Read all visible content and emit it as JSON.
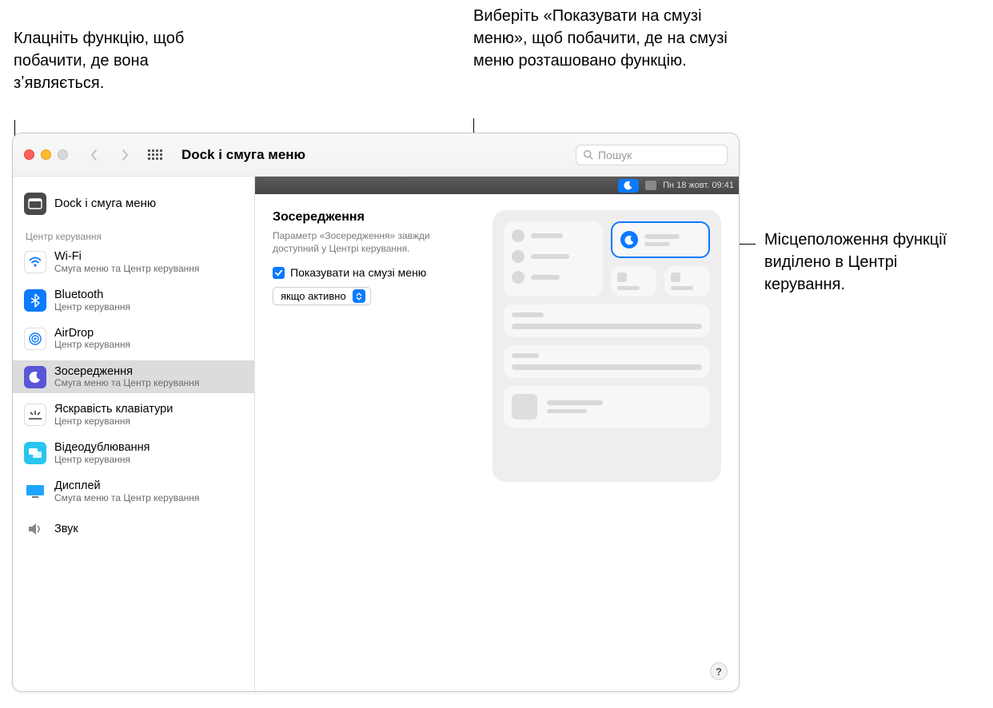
{
  "callouts": {
    "left": "Клацніть функцію, щоб побачити, де вона зʼявляється.",
    "top": "Виберіть «Показувати на смузі меню», щоб побачити, де на смузі меню розташовано функцію.",
    "right": "Місцеположення функції виділено в Центрі керування."
  },
  "toolbar": {
    "title": "Dock і смуга меню",
    "search_placeholder": "Пошук"
  },
  "preview_bar": {
    "datetime": "Пн 18 жовт.  09:41"
  },
  "sidebar": {
    "top": {
      "label": "Dock і смуга меню"
    },
    "section": "Центр керування",
    "items": [
      {
        "label": "Wi-Fi",
        "sub": "Смуга меню та Центр керування",
        "icon": "wifi"
      },
      {
        "label": "Bluetooth",
        "sub": "Центр керування",
        "icon": "bt"
      },
      {
        "label": "AirDrop",
        "sub": "Центр керування",
        "icon": "airdrop"
      },
      {
        "label": "Зосередження",
        "sub": "Смуга меню та Центр керування",
        "icon": "focus",
        "selected": true
      },
      {
        "label": "Яскравість клавіатури",
        "sub": "Центр керування",
        "icon": "kbr"
      },
      {
        "label": "Відеодублювання",
        "sub": "Центр керування",
        "icon": "mirror"
      },
      {
        "label": "Дисплей",
        "sub": "Смуга меню та Центр керування",
        "icon": "display"
      },
      {
        "label": "Звук",
        "sub": "",
        "icon": "sound"
      }
    ]
  },
  "main": {
    "heading": "Зосередження",
    "desc": "Параметр «Зосередження» завжди доступний у Центрі керування.",
    "checkbox_label": "Показувати на смузі меню",
    "select_value": "якщо активно"
  },
  "help": "?"
}
